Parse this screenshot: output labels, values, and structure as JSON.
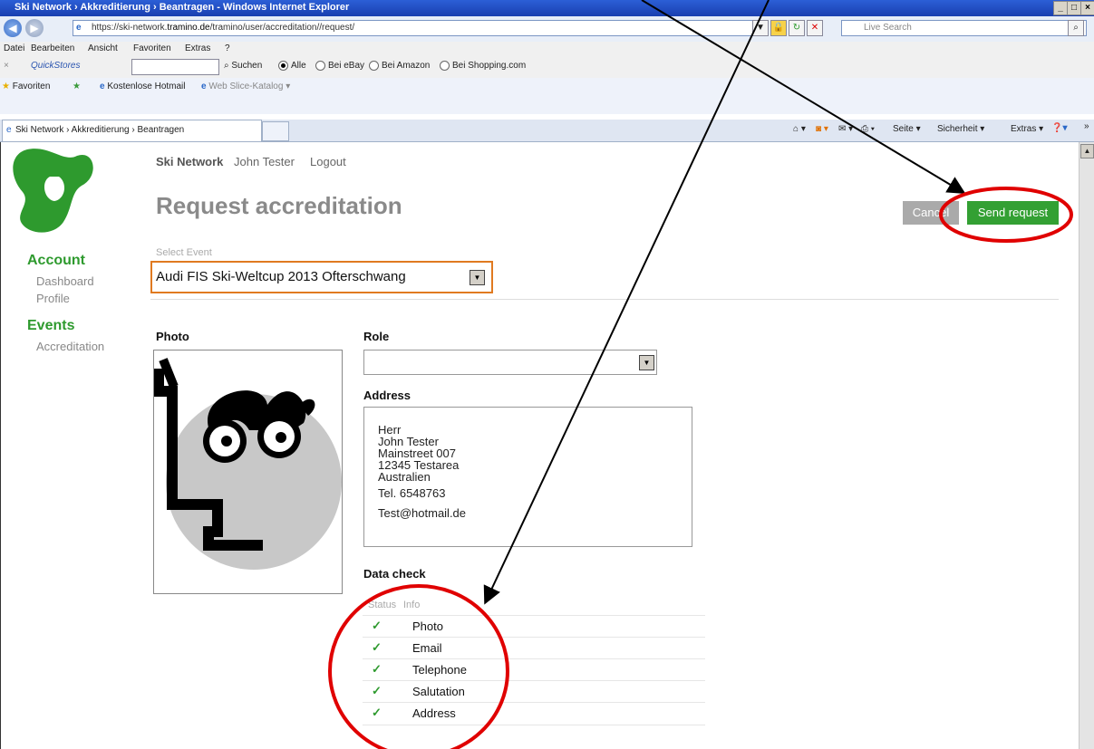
{
  "window": {
    "title": "Ski Network › Akkreditierung › Beantragen - Windows Internet Explorer",
    "controls": [
      "_",
      "□",
      "×"
    ]
  },
  "browser": {
    "address_prefix": "https://ski-network.",
    "address_host": "tramino.de",
    "address_path": "/tramino/user/accreditation//request/",
    "live_search_placeholder": "Live Search",
    "menu": [
      "Datei",
      "Bearbeiten",
      "Ansicht",
      "Favoriten",
      "Extras",
      "?"
    ],
    "quickstores": "QuickStores",
    "suchen": "Suchen",
    "search_options": [
      "Alle",
      "Bei eBay",
      "Bei Amazon",
      "Bei Shopping.com"
    ],
    "favorites_label": "Favoriten",
    "fav_links": [
      "Kostenlose Hotmail",
      "Web Slice-Katalog"
    ],
    "tab_title": "Ski Network › Akkreditierung › Beantragen",
    "command_items": [
      "Seite",
      "Sicherheit",
      "Extras"
    ]
  },
  "topnav": {
    "brand": "Ski Network",
    "user": "John Tester",
    "logout": "Logout"
  },
  "page_title": "Request accreditation",
  "buttons": {
    "cancel": "Cancel",
    "send": "Send request"
  },
  "sidebar": {
    "account_heading": "Account",
    "account_items": [
      "Dashboard",
      "Profile"
    ],
    "events_heading": "Events",
    "events_items": [
      "Accreditation"
    ]
  },
  "event_select": {
    "label": "Select Event",
    "value": "Audi FIS Ski-Weltcup 2013 Ofterschwang"
  },
  "photo_label": "Photo",
  "role": {
    "label": "Role",
    "value": ""
  },
  "address": {
    "label": "Address",
    "salutation": "Herr",
    "name": "John Tester",
    "street": "Mainstreet 007",
    "city": "12345 Testarea",
    "country": "Australien",
    "tel": "Tel. 6548763",
    "email": "Test@hotmail.de"
  },
  "data_check": {
    "label": "Data check",
    "col_status": "Status",
    "col_info": "Info",
    "rows": [
      {
        "status": "✓",
        "info": "Photo"
      },
      {
        "status": "✓",
        "info": "Email"
      },
      {
        "status": "✓",
        "info": "Telephone"
      },
      {
        "status": "✓",
        "info": "Salutation"
      },
      {
        "status": "✓",
        "info": "Address"
      }
    ]
  },
  "colors": {
    "accent_green": "#3a9a3a",
    "send_button": "#33a033",
    "cancel_button": "#aaaaaa",
    "annotation_red": "#e00000",
    "select_border": "#e07a20"
  }
}
